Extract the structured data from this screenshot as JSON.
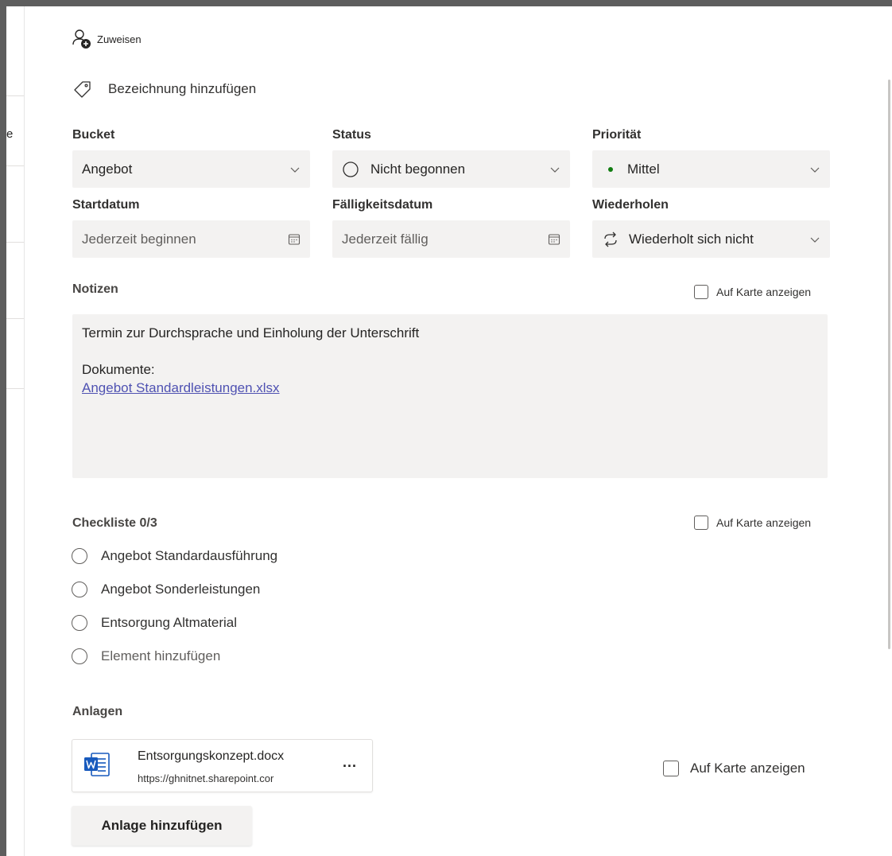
{
  "backdrop": {
    "fragment_char": "e"
  },
  "assign": {
    "label": "Zuweisen",
    "icon": "person-add-icon"
  },
  "label_add": {
    "label": "Bezeichnung hinzufügen",
    "icon": "tag-icon"
  },
  "fields": {
    "bucket": {
      "label": "Bucket",
      "value": "Angebot"
    },
    "status": {
      "label": "Status",
      "value": "Nicht begonnen"
    },
    "priority": {
      "label": "Priorität",
      "value": "Mittel",
      "dot_color": "#107c10"
    },
    "start_date": {
      "label": "Startdatum",
      "placeholder": "Jederzeit beginnen"
    },
    "due_date": {
      "label": "Fälligkeitsdatum",
      "placeholder": "Jederzeit fällig"
    },
    "repeat": {
      "label": "Wiederholen",
      "value": "Wiederholt sich nicht"
    }
  },
  "notes": {
    "title": "Notizen",
    "show_on_card": "Auf Karte anzeigen",
    "line1": "Termin zur Durchsprache und Einholung der Unterschrift",
    "line2": "Dokumente:",
    "link": "Angebot Standardleistungen.xlsx"
  },
  "checklist": {
    "title": "Checkliste 0/3",
    "show_on_card": "Auf Karte anzeigen",
    "items": [
      {
        "label": "Angebot Standardausführung"
      },
      {
        "label": "Angebot Sonderleistungen"
      },
      {
        "label": "Entsorgung Altmaterial"
      }
    ],
    "add_placeholder": "Element hinzufügen"
  },
  "attachments": {
    "title": "Anlagen",
    "file": {
      "name": "Entsorgungskonzept.docx",
      "url": "https://ghnitnet.sharepoint.cor",
      "more": "...",
      "icon": "word-file-icon"
    },
    "show_on_card": "Auf Karte anzeigen",
    "add_button": "Anlage hinzufügen"
  },
  "colors": {
    "link": "#4f52b2",
    "field_bg": "#f3f2f1",
    "priority_dot": "#107c10"
  }
}
